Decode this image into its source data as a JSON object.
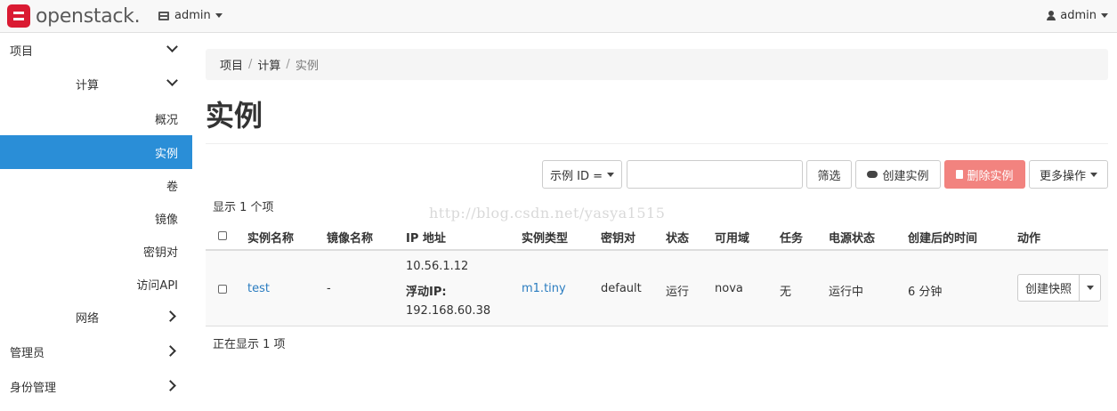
{
  "header": {
    "logo_text": "openstack.",
    "project_label": "admin",
    "user_label": "admin"
  },
  "sidebar": {
    "items": [
      {
        "label": "项目"
      },
      {
        "label": "计算"
      },
      {
        "label": "概况"
      },
      {
        "label": "实例"
      },
      {
        "label": "卷"
      },
      {
        "label": "镜像"
      },
      {
        "label": "密钥对"
      },
      {
        "label": "访问API"
      },
      {
        "label": "网络"
      },
      {
        "label": "管理员"
      },
      {
        "label": "身份管理"
      }
    ]
  },
  "breadcrumb": [
    "项目",
    "计算",
    "实例"
  ],
  "page_title": "实例",
  "toolbar": {
    "filter_select": "示例 ID =",
    "filter_input_value": "",
    "filter_button": "筛选",
    "create_button": "创建实例",
    "delete_button": "删除实例",
    "more_button": "更多操作"
  },
  "count_text": "显示 1 个项",
  "footer_text": "正在显示 1 项",
  "watermark": "http://blog.csdn.net/yasya1515",
  "table": {
    "headers": [
      "实例名称",
      "镜像名称",
      "IP 地址",
      "实例类型",
      "密钥对",
      "状态",
      "可用域",
      "任务",
      "电源状态",
      "创建后的时间",
      "动作"
    ],
    "rows": [
      {
        "name": "test",
        "image": "-",
        "ip_fixed": "10.56.1.12",
        "ip_floating_label": "浮动IP:",
        "ip_floating": "192.168.60.38",
        "flavor": "m1.tiny",
        "keypair": "default",
        "status": "运行",
        "zone": "nova",
        "task": "无",
        "power": "运行中",
        "age": "6 分钟",
        "action": "创建快照"
      }
    ]
  },
  "colors": {
    "active_nav": "#2a8ed7",
    "danger": "#f2837f",
    "link": "#2a7cc0",
    "logo": "#da1a32"
  }
}
